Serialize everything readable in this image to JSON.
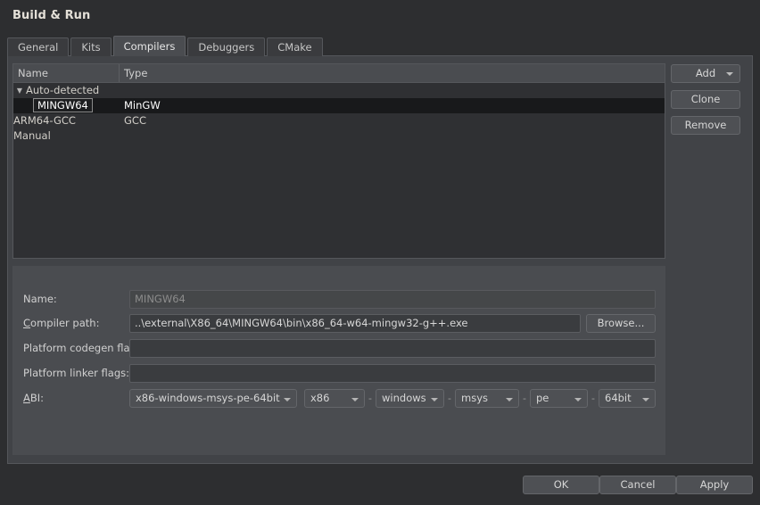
{
  "window": {
    "title": "Build & Run"
  },
  "tabs": [
    {
      "label": "General",
      "active": false
    },
    {
      "label": "Kits",
      "active": false
    },
    {
      "label": "Compilers",
      "active": true
    },
    {
      "label": "Debuggers",
      "active": false
    },
    {
      "label": "CMake",
      "active": false
    }
  ],
  "tree": {
    "columns": [
      {
        "label": "Name"
      },
      {
        "label": "Type"
      }
    ],
    "rows": [
      {
        "name": "Auto-detected",
        "type": "",
        "level": 0,
        "expanded": true,
        "selected": false,
        "editing": false
      },
      {
        "name": "MINGW64",
        "type": "MinGW",
        "level": 1,
        "expanded": false,
        "selected": true,
        "editing": true
      },
      {
        "name": "ARM64-GCC",
        "type": "GCC",
        "level": 1,
        "expanded": false,
        "selected": false,
        "editing": false
      },
      {
        "name": "Manual",
        "type": "",
        "level": 0,
        "expanded": false,
        "selected": false,
        "editing": false
      }
    ]
  },
  "side_buttons": {
    "add": "Add",
    "clone": "Clone",
    "remove": "Remove"
  },
  "detail": {
    "name_label": "Name:",
    "name_value": "MINGW64",
    "compiler_path_label_prefix": "",
    "compiler_path_label_mnemonic": "C",
    "compiler_path_label_rest": "ompiler path:",
    "compiler_path_value": "..\\external\\X86_64\\MINGW64\\bin\\x86_64-w64-mingw32-g++.exe",
    "browse_label": "Browse...",
    "platform_codegen_label": "Platform codegen flags:",
    "platform_codegen_value": "",
    "platform_linker_label": "Platform linker flags:",
    "platform_linker_value": "",
    "abi_label_mnemonic": "A",
    "abi_label_rest": "BI:",
    "abi_full": "x86-windows-msys-pe-64bit",
    "abi_parts": [
      "x86",
      "windows",
      "msys",
      "pe",
      "64bit"
    ],
    "abi_separator": "-"
  },
  "footer": {
    "ok": "OK",
    "cancel": "Cancel",
    "apply": "Apply"
  },
  "colors": {
    "dialog_bg": "#2d2e30",
    "panel_bg": "#414347",
    "detail_bg": "#4a4c50",
    "list_bg": "#2f3033",
    "selection_bg": "#18191b",
    "border": "#55575b",
    "text": "#c8c8c8"
  }
}
